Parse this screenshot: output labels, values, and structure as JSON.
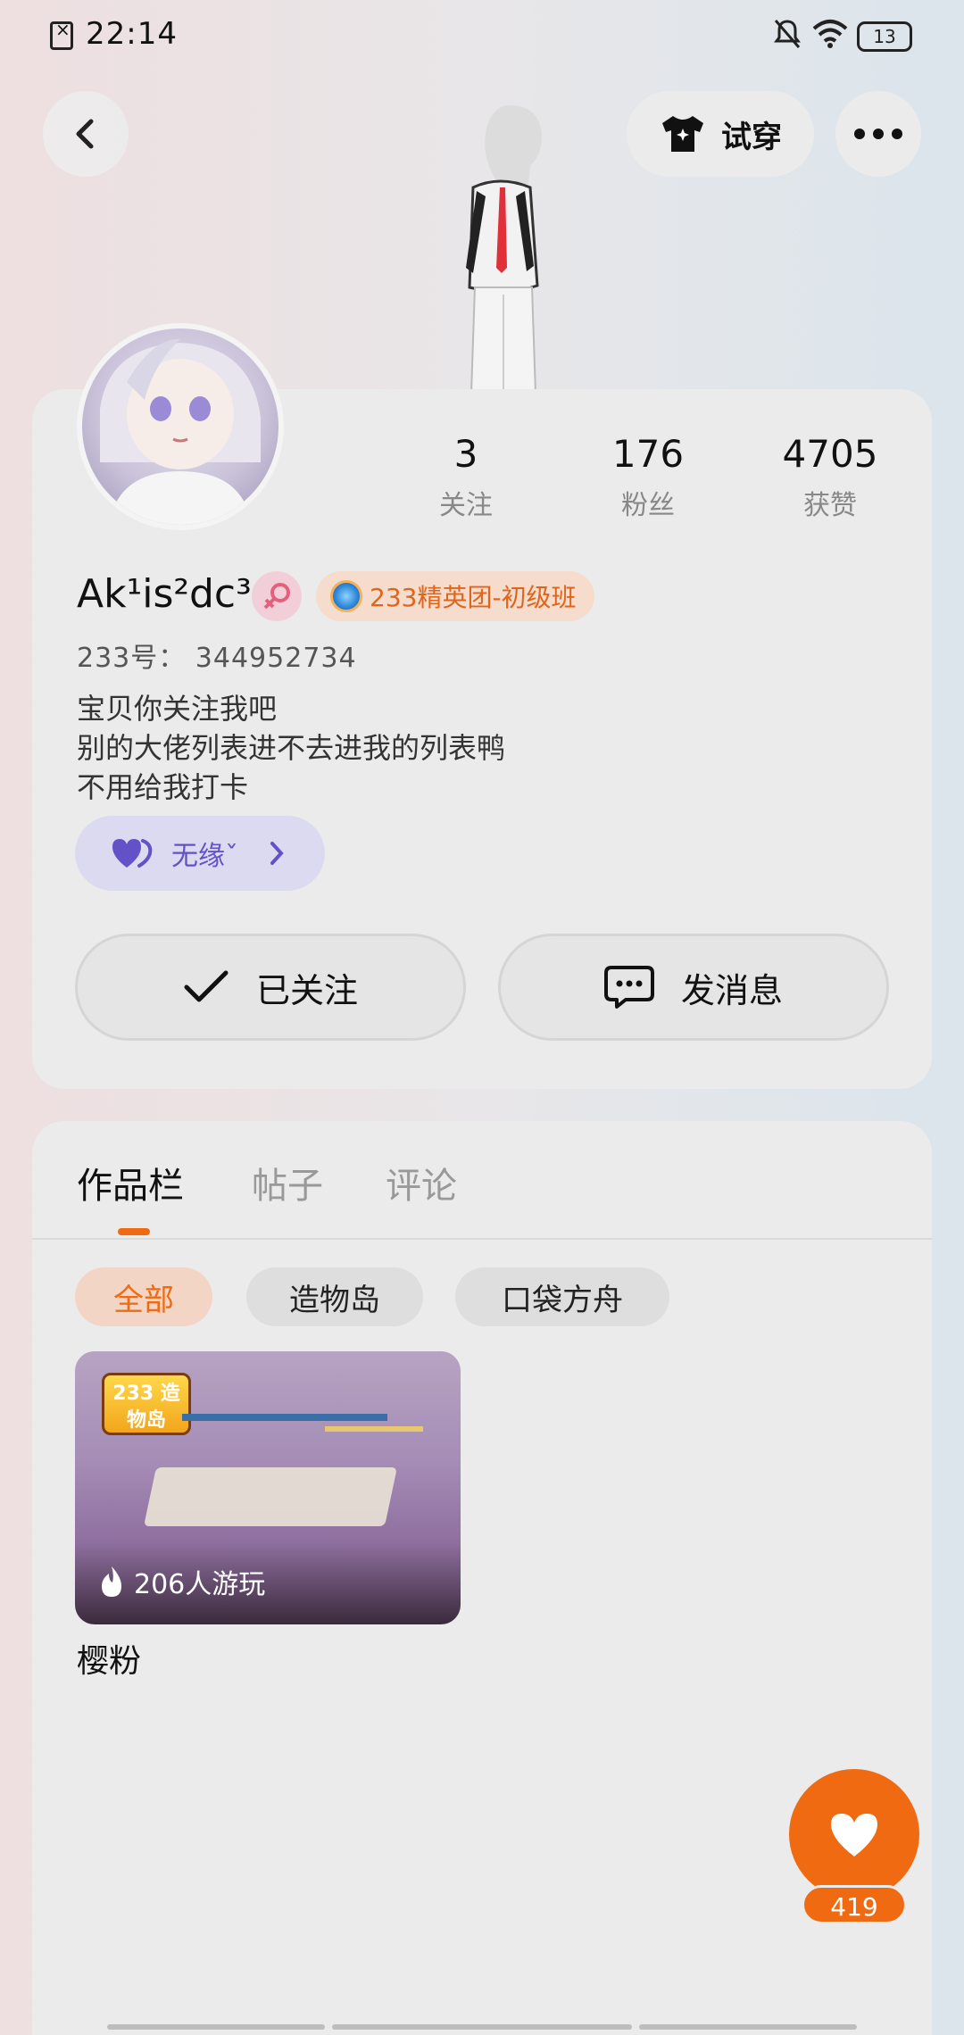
{
  "status": {
    "time": "22:14",
    "battery": "13"
  },
  "top": {
    "dress_label": "试穿"
  },
  "stats": [
    {
      "value": "3",
      "label": "关注"
    },
    {
      "value": "176",
      "label": "粉丝"
    },
    {
      "value": "4705",
      "label": "获赞"
    }
  ],
  "profile": {
    "username": "Ak¹is²dc³",
    "badge": "233精英团-初级班",
    "uid": "233号： 344952734",
    "bio": [
      "宝贝你关注我吧",
      "别的大佬列表进不去进我的列表鸭",
      "不用给我打卡"
    ],
    "bond": "无缘ˇ"
  },
  "actions": {
    "follow": "已关注",
    "message": "发消息"
  },
  "tabs": [
    "作品栏",
    "帖子",
    "评论"
  ],
  "filters": [
    "全部",
    "造物岛",
    "口袋方舟"
  ],
  "works": [
    {
      "logo": "233 造物岛",
      "plays": "206人游玩",
      "title": "樱粉"
    }
  ],
  "like": {
    "count": "419"
  },
  "colors": {
    "accent": "#f06a12",
    "bond": "#6352c7"
  }
}
